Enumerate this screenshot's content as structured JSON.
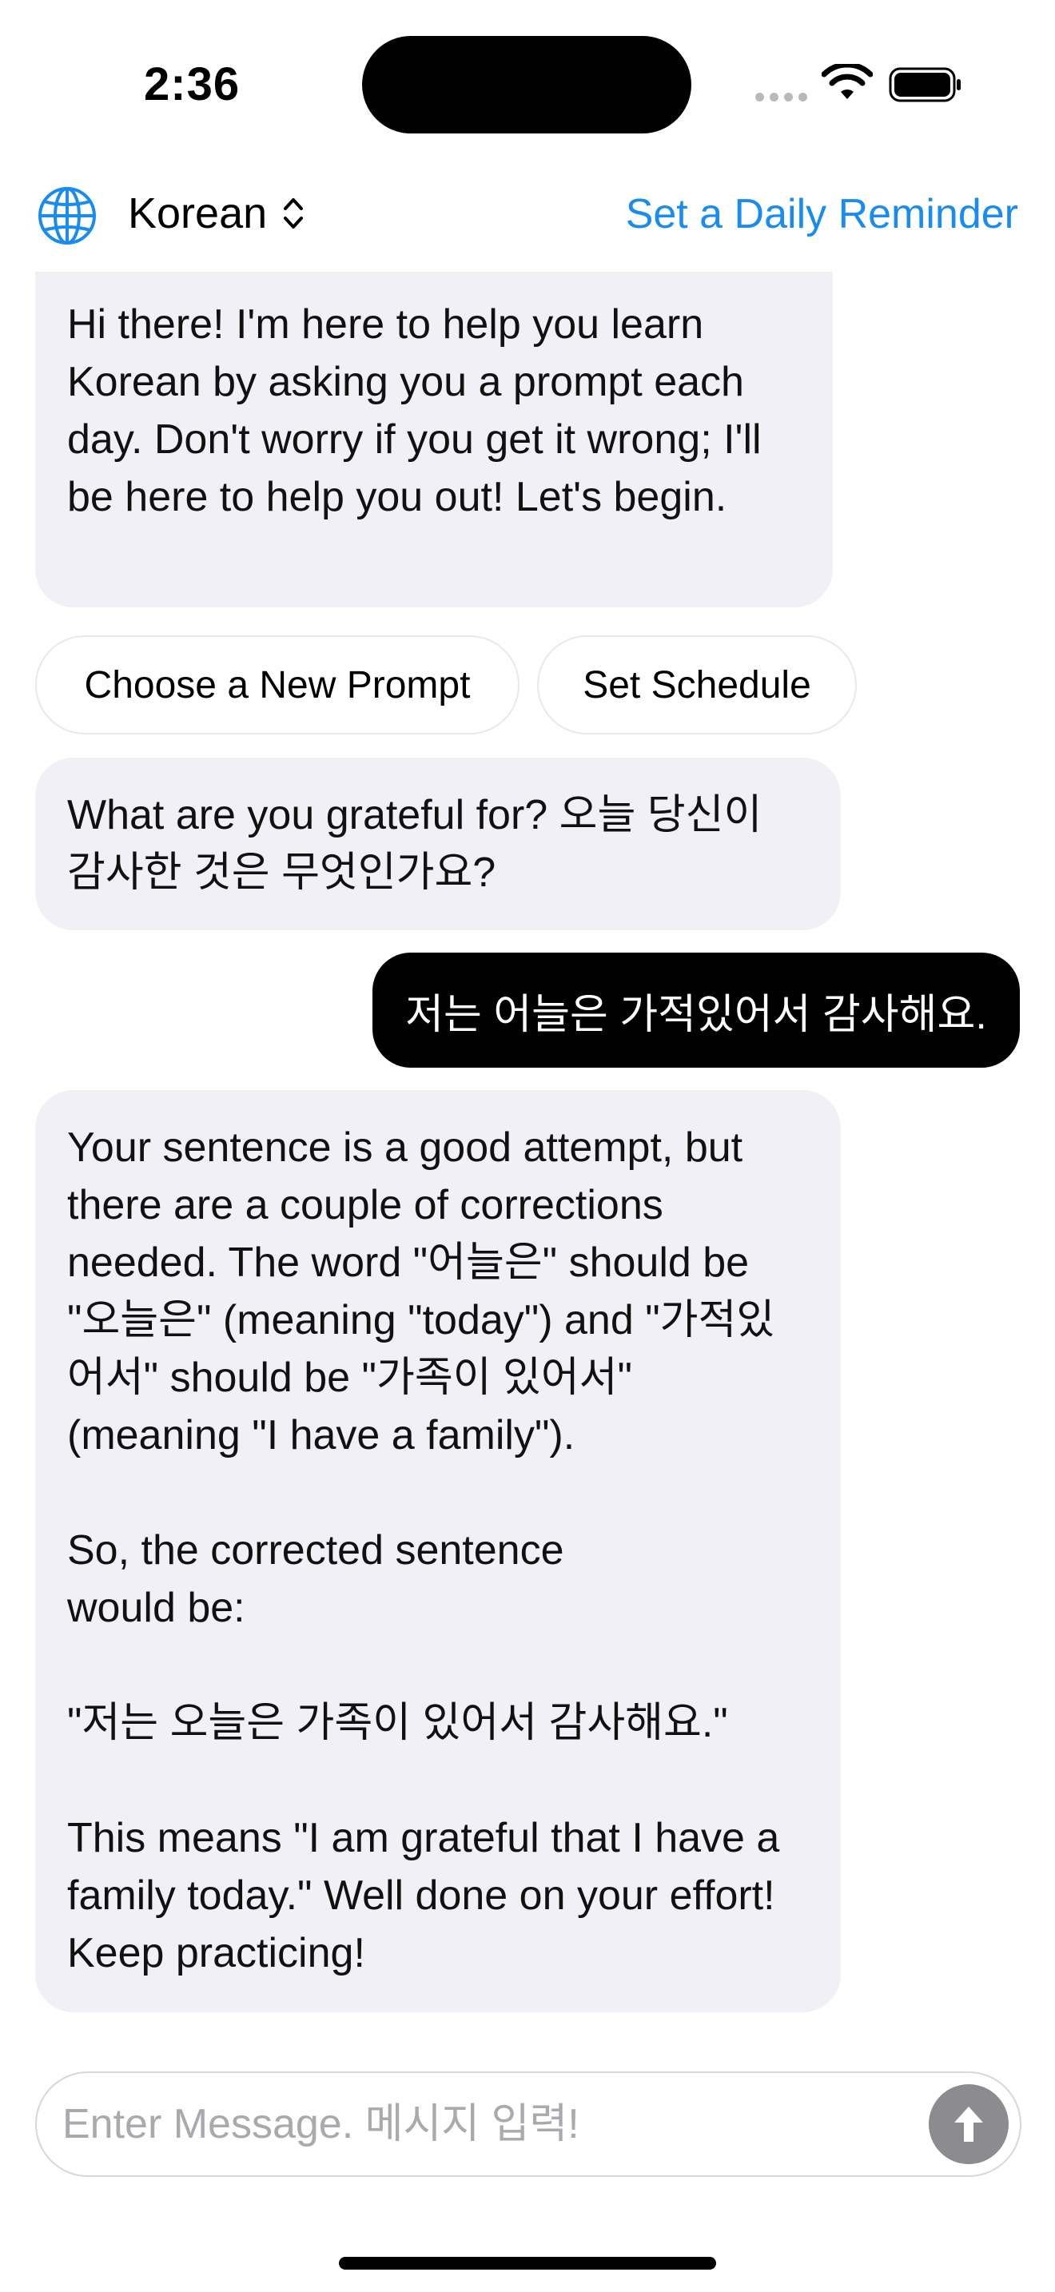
{
  "status_bar": {
    "time": "2:36"
  },
  "header": {
    "language": "Korean",
    "reminder_link": "Set a Daily Reminder"
  },
  "chat": {
    "intro_message": "Hi there! I'm here to help you learn Korean by asking you a prompt each day. Don't worry if you get it wrong; I'll be here to help you out! Let's begin.",
    "actions": {
      "new_prompt": "Choose a New Prompt",
      "set_schedule": "Set Schedule"
    },
    "prompt_message": "What are you grateful for? 오늘 당신이 감사한 것은 무엇인가요?",
    "user_message": "저는 어늘은 가적있어서 감사해요.",
    "feedback_message": "Your sentence is a good attempt, but there are a couple of corrections needed. The word \"어늘은\" should be \"오늘은\" (meaning \"today\") and \"가적있어서\" should be \"가족이 있어서\" (meaning \"I have a family\").\n\nSo, the corrected sentence\nwould be:\n\n\"저는 오늘은 가족이 있어서 감사해요.\"\n\nThis means \"I am grateful that I have a family today.\" Well done on your effort! Keep practicing!"
  },
  "composer": {
    "placeholder": "Enter Message. 메시지 입력!"
  },
  "colors": {
    "accent": "#1a8cf0",
    "bubble_bot": "#f0f0f6",
    "bubble_user": "#000000",
    "send_button": "#8c8c90"
  },
  "icons": {
    "language": "globe-icon",
    "language_toggle": "chevron-up-down-icon",
    "send": "arrow-up-icon",
    "wifi": "wifi-icon",
    "battery": "battery-icon"
  }
}
